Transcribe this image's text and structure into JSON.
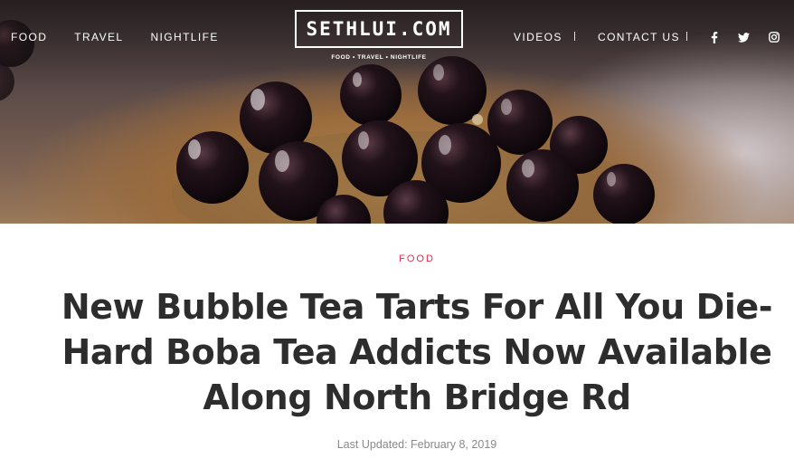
{
  "nav": {
    "left": [
      {
        "label": "FOOD"
      },
      {
        "label": "TRAVEL"
      },
      {
        "label": "NIGHTLIFE"
      }
    ],
    "right": [
      {
        "label": "VIDEOS"
      },
      {
        "label": "CONTACT US"
      }
    ],
    "social": [
      {
        "icon": "facebook-icon"
      },
      {
        "icon": "twitter-icon"
      },
      {
        "icon": "instagram-icon"
      }
    ]
  },
  "logo": {
    "text": "SETHLUI.COM",
    "tagline": "FOOD • TRAVEL • NIGHTLIFE"
  },
  "hero": {
    "description_icon": "hero-image"
  },
  "article": {
    "category": "FOOD",
    "headline": "New Bubble Tea Tarts For All You Die-Hard Boba Tea Addicts Now Available Along North Bridge Rd",
    "updated": "Last Updated: February 8, 2019"
  },
  "colors": {
    "accent": "#e0334d",
    "headline": "#2d2d2d",
    "meta": "#8a8a8a"
  }
}
